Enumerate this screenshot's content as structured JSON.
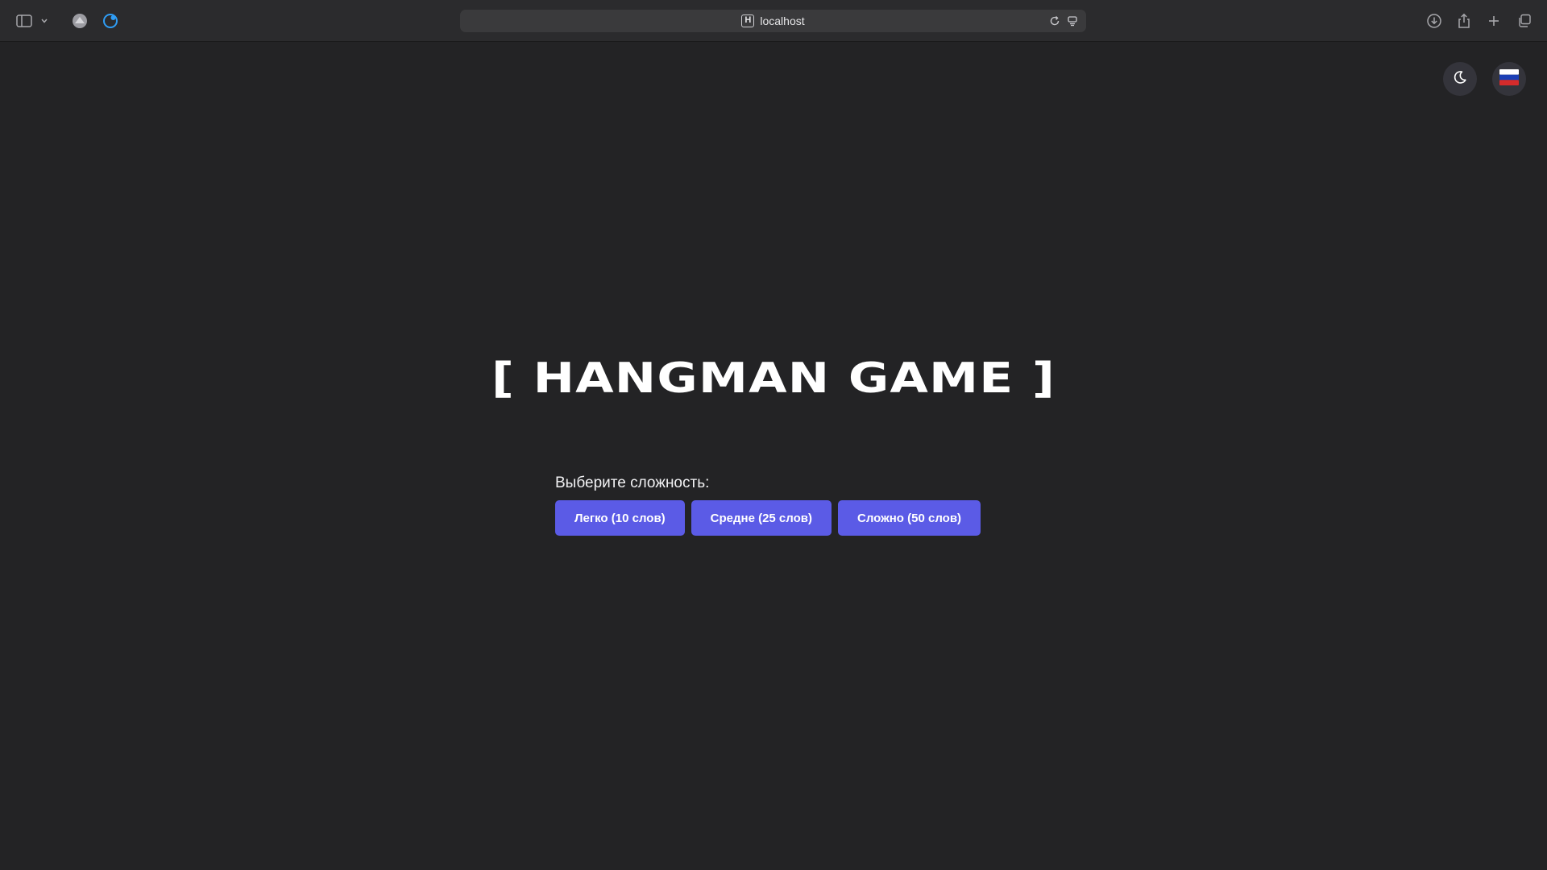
{
  "browser": {
    "url": "localhost",
    "favicon_letter": "H",
    "icons": {
      "sidebar": "sidebar-icon",
      "sidebar_menu": "chevron-down-icon",
      "extension_1": "extension-icon",
      "extension_2": "extension-icon",
      "reload": "reload-icon",
      "reader": "reader-icon",
      "download": "download-icon",
      "share": "share-icon",
      "new_tab": "plus-icon",
      "tab_overview": "tabs-icon"
    }
  },
  "page": {
    "theme_toggle_icon": "moon-icon",
    "language_icon": "russian-flag-icon",
    "title": "[ HANGMAN GAME ]",
    "difficulty": {
      "prompt": "Выберите сложность:",
      "buttons": [
        {
          "label": "Легко (10 слов)"
        },
        {
          "label": "Средне (25 слов)"
        },
        {
          "label": "Сложно (50 слов)"
        }
      ]
    }
  },
  "colors": {
    "background": "#232325",
    "accent": "#5b5be6",
    "text": "#ffffff"
  }
}
